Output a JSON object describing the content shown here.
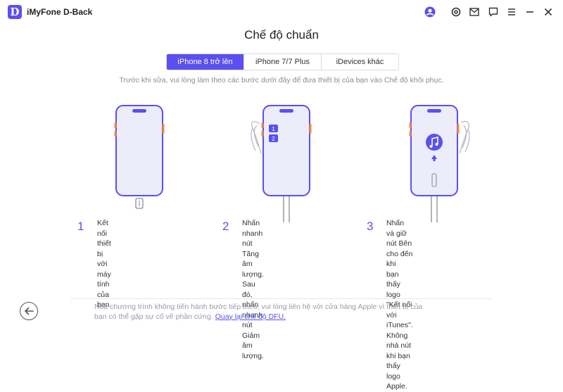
{
  "app": {
    "logo_letter": "D",
    "title": "iMyFone D-Back"
  },
  "window_icons": [
    "user-icon",
    "settings-icon",
    "mail-icon",
    "feedback-icon",
    "menu-icon",
    "minimize-icon",
    "close-icon"
  ],
  "page": {
    "title": "Chế độ chuẩn",
    "tabs": [
      {
        "label": "iPhone 8 trở lên",
        "active": true
      },
      {
        "label": "iPhone 7/7 Plus",
        "active": false
      },
      {
        "label": "iDevices khác",
        "active": false
      }
    ],
    "instruction": "Trước khi sửa, vui lòng làm theo các bước dưới đây để đưa thiết bị của bạn vào Chế độ khôi phục."
  },
  "steps": [
    {
      "number": "1",
      "text_lines": [
        "Kết nối thiết bị với máy tính của",
        "bạn."
      ]
    },
    {
      "number": "2",
      "text_lines": [
        "Nhấn nhanh nút Tăng âm",
        "lượng. Sau đó, nhấn nhanh nút",
        "Giảm âm lượng."
      ],
      "badges": [
        "1",
        "2"
      ]
    },
    {
      "number": "3",
      "text_lines": [
        "Nhấn và giữ nút Bên cho đến khi",
        "bạn thấy logo \"Kết nối với",
        "iTunes\". Không nhả nút khi bạn",
        "thấy logo Apple."
      ]
    }
  ],
  "footer": {
    "text": "Nếu chương trình không tiến hành bước tiếp theo, vui lòng liên hệ với cửa hàng Apple vì thiết bị của bạn có thể gặp sự cố về phần cứng.",
    "link": "Quay lại chế độ DFU."
  },
  "colors": {
    "accent": "#5b4ff0",
    "button_orange": "#f08a3c",
    "phone_outline": "#5b4ff0",
    "screen_fill": "#ececfa"
  }
}
